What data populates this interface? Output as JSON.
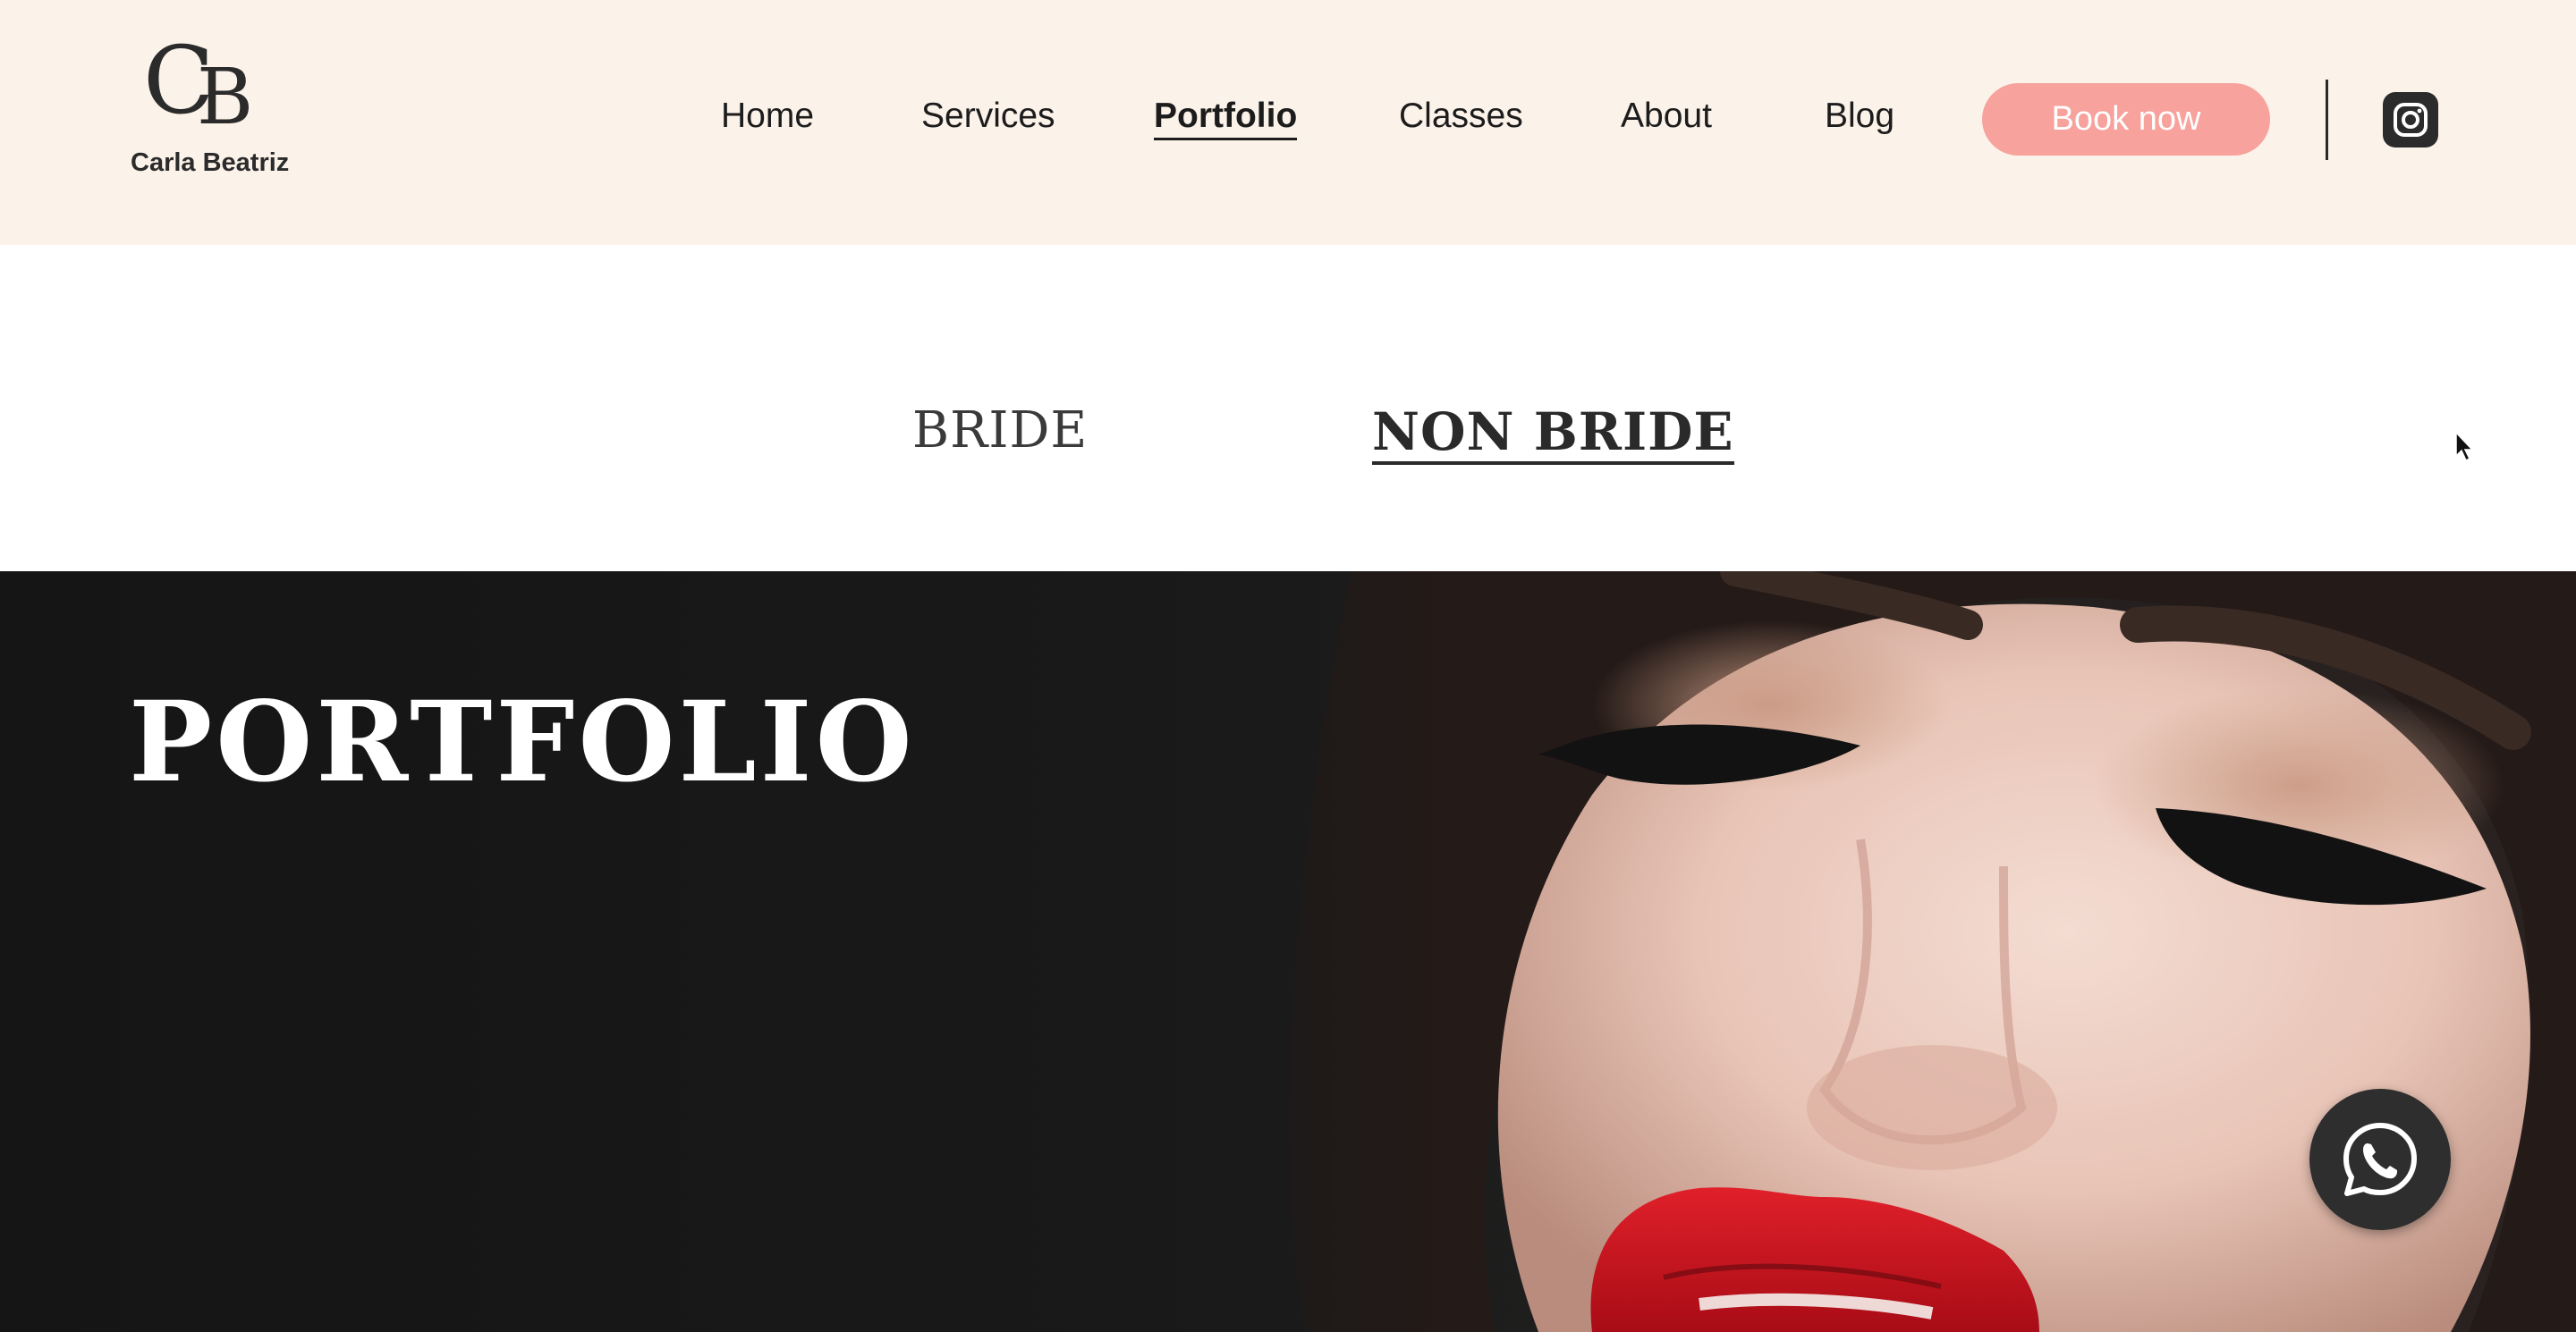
{
  "brand": {
    "monogram_c": "C",
    "monogram_b": "B",
    "name": "Carla Beatriz"
  },
  "nav": {
    "items": [
      {
        "label": "Home",
        "active": false
      },
      {
        "label": "Services",
        "active": false
      },
      {
        "label": "Portfolio",
        "active": true
      },
      {
        "label": "Classes",
        "active": false
      },
      {
        "label": "About",
        "active": false
      },
      {
        "label": "Blog",
        "active": false
      }
    ],
    "book_label": "Book now",
    "social_icon": "instagram-icon"
  },
  "tabs": {
    "items": [
      {
        "label": "BRIDE",
        "selected": false
      },
      {
        "label": "NON BRIDE",
        "selected": true
      }
    ]
  },
  "hero": {
    "title": "PORTFOLIO",
    "image_subject": "close-up portrait, closed eyes, winged eyeliner, red lips"
  },
  "floating": {
    "chat_icon": "whatsapp-icon"
  },
  "colors": {
    "header_bg": "#fbf2e9",
    "accent": "#f7a29c",
    "dark": "#2b2b2b",
    "hero_bg": "#1a1a1a",
    "lip_red": "#c8101c"
  }
}
